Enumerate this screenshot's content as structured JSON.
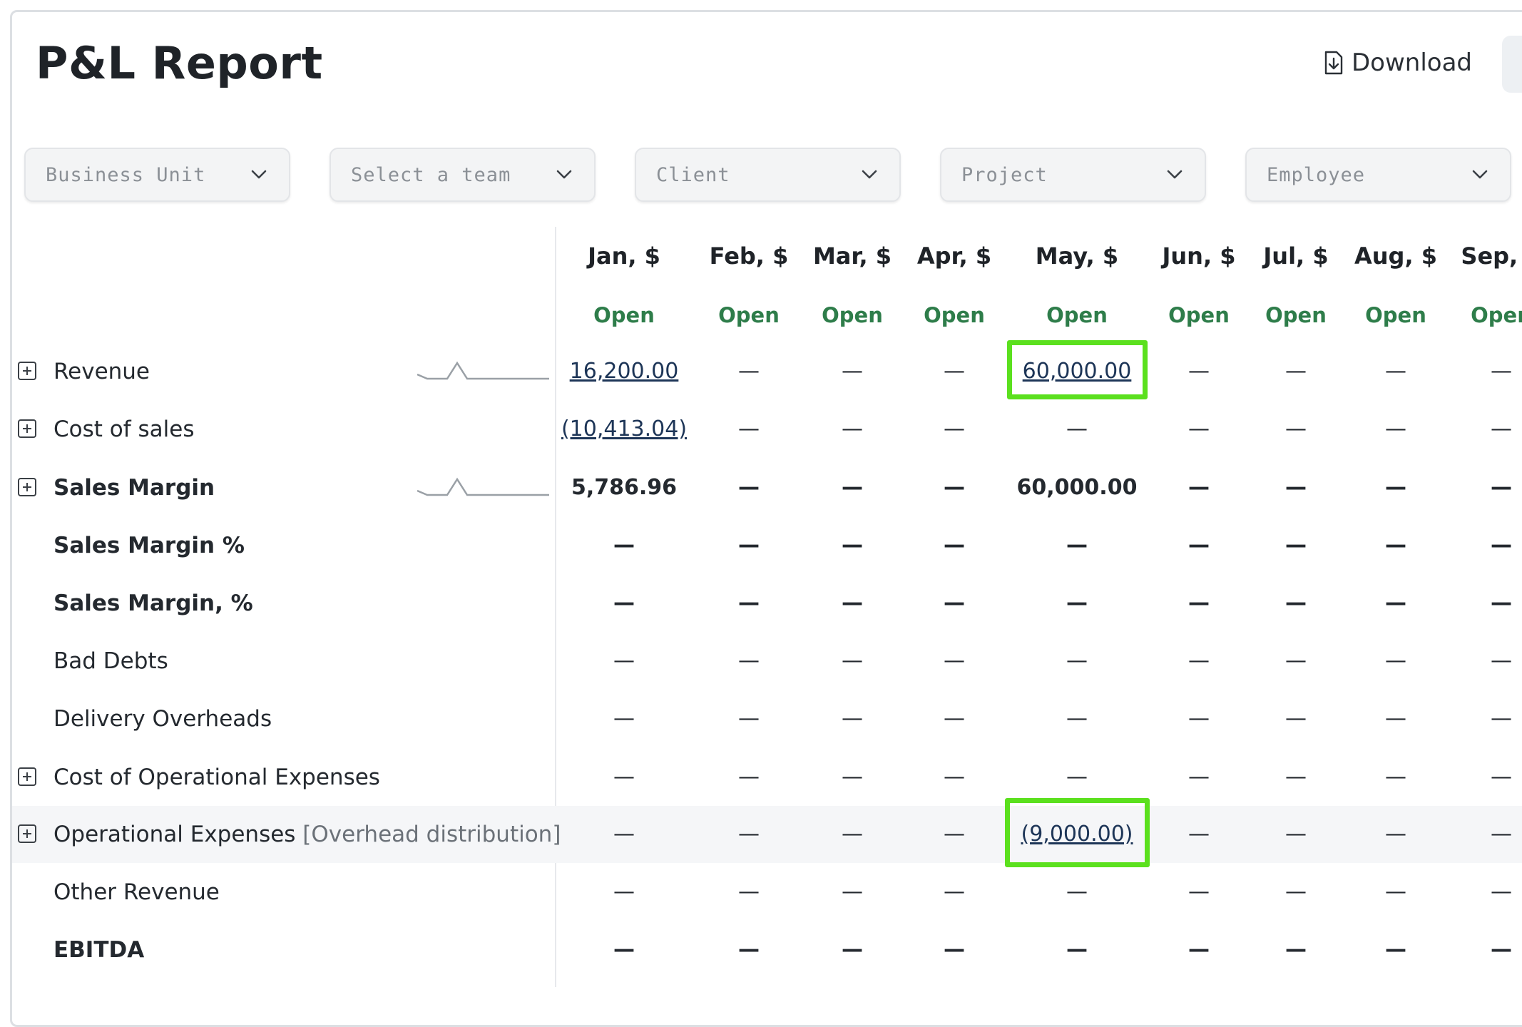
{
  "title": "P&L Report",
  "download_label": "Download",
  "filters": [
    {
      "id": "business-unit",
      "placeholder": "Business Unit"
    },
    {
      "id": "team",
      "placeholder": "Select a team"
    },
    {
      "id": "client",
      "placeholder": "Client"
    },
    {
      "id": "project",
      "placeholder": "Project"
    },
    {
      "id": "employee",
      "placeholder": "Employee"
    }
  ],
  "months": [
    "Jan, $",
    "Feb, $",
    "Mar, $",
    "Apr, $",
    "May, $",
    "Jun, $",
    "Jul, $",
    "Aug, $",
    "Sep, $"
  ],
  "statuses": [
    "Open",
    "Open",
    "Open",
    "Open",
    "Open",
    "Open",
    "Open",
    "Open",
    "Open"
  ],
  "rows": [
    {
      "label": "Revenue",
      "expandable": true,
      "bold": false,
      "sparkline": true,
      "values": [
        "16,200.00",
        "—",
        "—",
        "—",
        "60,000.00",
        "—",
        "—",
        "—",
        "—"
      ],
      "links": [
        0,
        4
      ],
      "highlight_cell": 4
    },
    {
      "label": "Cost of sales",
      "expandable": true,
      "bold": false,
      "values": [
        "(10,413.04)",
        "—",
        "—",
        "—",
        "—",
        "—",
        "—",
        "—",
        "—"
      ],
      "links": [
        0
      ]
    },
    {
      "label": "Sales Margin",
      "expandable": true,
      "bold": true,
      "sparkline": true,
      "values": [
        "5,786.96",
        "—",
        "—",
        "—",
        "60,000.00",
        "—",
        "—",
        "—",
        "—"
      ],
      "links": []
    },
    {
      "label": "Sales Margin %",
      "expandable": false,
      "bold": true,
      "values": [
        "—",
        "—",
        "—",
        "—",
        "—",
        "—",
        "—",
        "—",
        "—"
      ],
      "links": []
    },
    {
      "label": "Sales Margin, %",
      "expandable": false,
      "bold": true,
      "values": [
        "—",
        "—",
        "—",
        "—",
        "—",
        "—",
        "—",
        "—",
        "—"
      ],
      "links": []
    },
    {
      "label": "Bad Debts",
      "expandable": false,
      "bold": false,
      "values": [
        "—",
        "—",
        "—",
        "—",
        "—",
        "—",
        "—",
        "—",
        "—"
      ],
      "links": []
    },
    {
      "label": "Delivery Overheads",
      "expandable": false,
      "bold": false,
      "values": [
        "—",
        "—",
        "—",
        "—",
        "—",
        "—",
        "—",
        "—",
        "—"
      ],
      "links": []
    },
    {
      "label": "Cost of Operational Expenses",
      "expandable": true,
      "bold": false,
      "values": [
        "—",
        "—",
        "—",
        "—",
        "—",
        "—",
        "—",
        "—",
        "—"
      ],
      "links": []
    },
    {
      "label": "Operational Expenses",
      "suffix": "[Overhead distribution]",
      "expandable": true,
      "bold": false,
      "highlight_row": true,
      "values": [
        "—",
        "—",
        "—",
        "—",
        "(9,000.00)",
        "—",
        "—",
        "—",
        "—"
      ],
      "links": [
        4
      ],
      "highlight_cell": 4
    },
    {
      "label": "Other Revenue",
      "expandable": false,
      "bold": false,
      "values": [
        "—",
        "—",
        "—",
        "—",
        "—",
        "—",
        "—",
        "—",
        "—"
      ],
      "links": []
    },
    {
      "label": "EBITDA",
      "expandable": false,
      "bold": true,
      "values": [
        "—",
        "—",
        "—",
        "—",
        "—",
        "—",
        "—",
        "—",
        "—"
      ],
      "links": []
    }
  ],
  "colors": {
    "accent_highlight": "#5be01e",
    "status_open": "#2e7d4a",
    "link": "#1d3557"
  }
}
